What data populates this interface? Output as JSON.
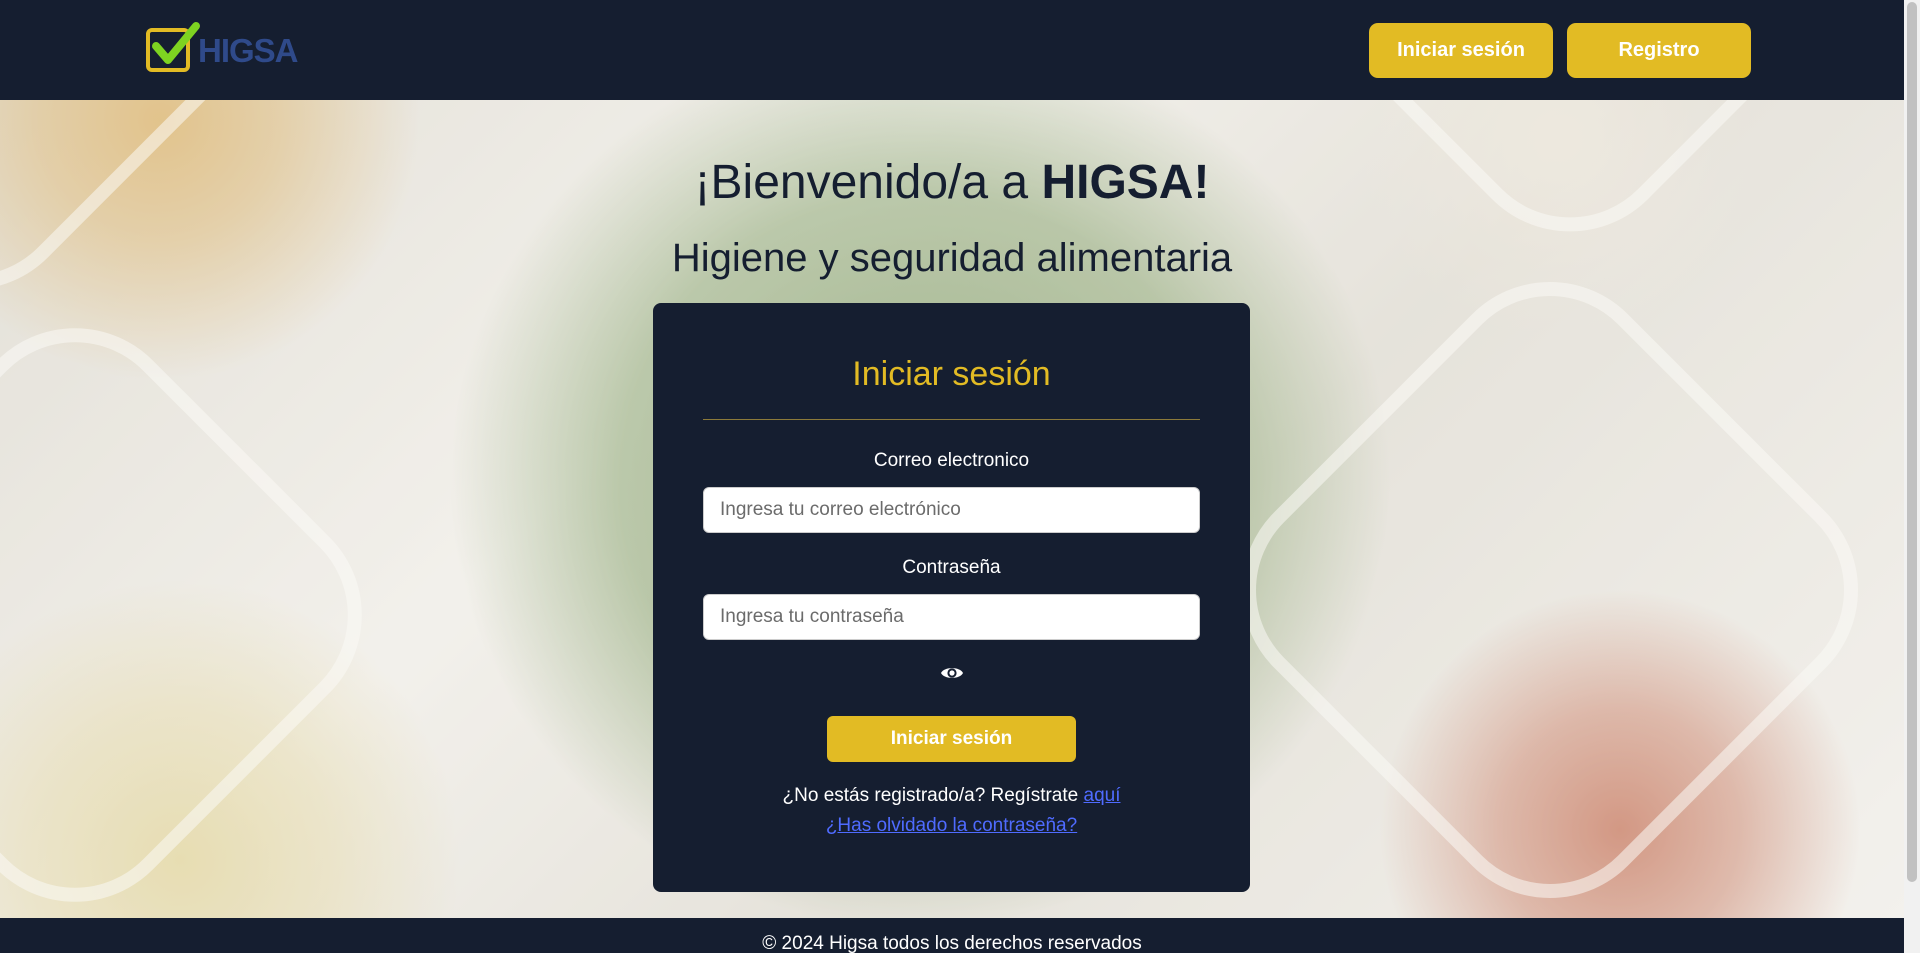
{
  "navbar": {
    "logo_text": "HIGSA",
    "login_label": "Iniciar sesión",
    "register_label": "Registro"
  },
  "hero": {
    "welcome_prefix": "¡Bienvenido/a a ",
    "welcome_brand": "HIGSA!",
    "tagline": "Higiene y seguridad alimentaria"
  },
  "login_form": {
    "title": "Iniciar sesión",
    "email_label": "Correo electronico",
    "email_placeholder": "Ingresa tu correo electrónico",
    "email_value": "",
    "password_label": "Contraseña",
    "password_placeholder": "Ingresa tu contraseña",
    "password_value": "",
    "show_password_icon": "eye-icon",
    "submit_label": "Iniciar sesión",
    "register_prompt": "¿No estás registrado/a? Regístrate ",
    "register_link": "aquí",
    "forgot_link": "¿Has olvidado la contraseña?"
  },
  "footer": {
    "text": "© 2024 Higsa todos los derechos reservados"
  },
  "colors": {
    "navy": "#151e30",
    "accent_yellow": "#e2bb24",
    "link_blue": "#4f6bff",
    "logo_blue": "#2f4a8a",
    "check_green": "#7ed321"
  }
}
